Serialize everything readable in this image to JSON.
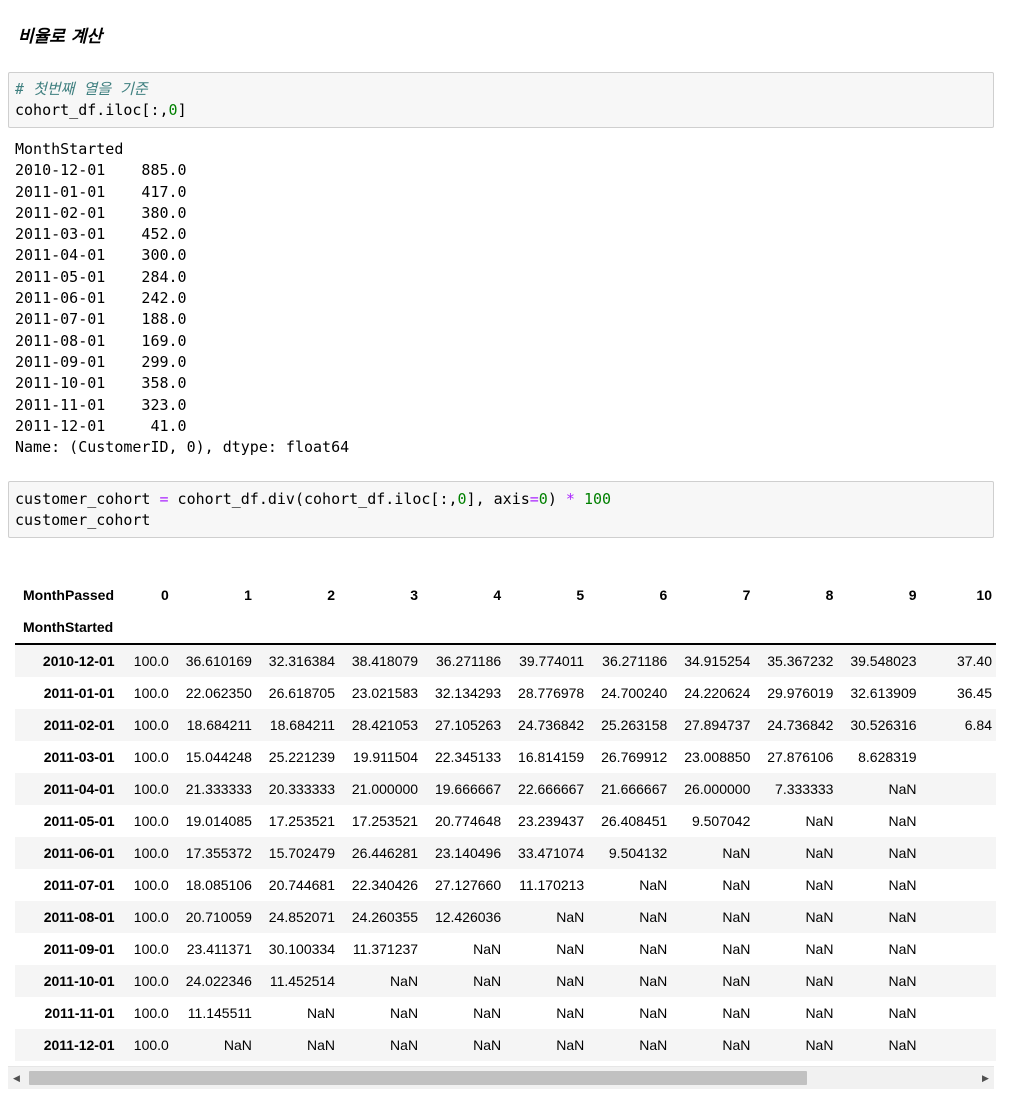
{
  "heading": "비율로 계산",
  "cell1": {
    "comment": "# 첫번째 열을 기준",
    "code_a": "cohort_df.iloc[:,",
    "code_num": "0",
    "code_b": "]"
  },
  "series_output": {
    "header": "MonthStarted",
    "rows": [
      "2010-12-01    885.0",
      "2011-01-01    417.0",
      "2011-02-01    380.0",
      "2011-03-01    452.0",
      "2011-04-01    300.0",
      "2011-05-01    284.0",
      "2011-06-01    242.0",
      "2011-07-01    188.0",
      "2011-08-01    169.0",
      "2011-09-01    299.0",
      "2011-10-01    358.0",
      "2011-11-01    323.0",
      "2011-12-01     41.0"
    ],
    "footer": "Name: (CustomerID, 0), dtype: float64"
  },
  "cell2": {
    "p1": "customer_cohort ",
    "eq": "=",
    "p2": " cohort_df.div(cohort_df.iloc[:,",
    "n0": "0",
    "p3": "], axis",
    "eq2": "=",
    "n1": "0",
    "p4": ") ",
    "star": "*",
    "sp": " ",
    "n100": "100",
    "line2": "customer_cohort"
  },
  "dataframe": {
    "columns_name": "MonthPassed",
    "index_name": "MonthStarted",
    "columns": [
      "0",
      "1",
      "2",
      "3",
      "4",
      "5",
      "6",
      "7",
      "8",
      "9",
      "10"
    ],
    "rows": [
      {
        "index": "2010-12-01",
        "values": [
          "100.0",
          "36.610169",
          "32.316384",
          "38.418079",
          "36.271186",
          "39.774011",
          "36.271186",
          "34.915254",
          "35.367232",
          "39.548023",
          "37.40"
        ]
      },
      {
        "index": "2011-01-01",
        "values": [
          "100.0",
          "22.062350",
          "26.618705",
          "23.021583",
          "32.134293",
          "28.776978",
          "24.700240",
          "24.220624",
          "29.976019",
          "32.613909",
          "36.45"
        ]
      },
      {
        "index": "2011-02-01",
        "values": [
          "100.0",
          "18.684211",
          "18.684211",
          "28.421053",
          "27.105263",
          "24.736842",
          "25.263158",
          "27.894737",
          "24.736842",
          "30.526316",
          "6.84"
        ]
      },
      {
        "index": "2011-03-01",
        "values": [
          "100.0",
          "15.044248",
          "25.221239",
          "19.911504",
          "22.345133",
          "16.814159",
          "26.769912",
          "23.008850",
          "27.876106",
          "8.628319",
          ""
        ]
      },
      {
        "index": "2011-04-01",
        "values": [
          "100.0",
          "21.333333",
          "20.333333",
          "21.000000",
          "19.666667",
          "22.666667",
          "21.666667",
          "26.000000",
          "7.333333",
          "NaN",
          ""
        ]
      },
      {
        "index": "2011-05-01",
        "values": [
          "100.0",
          "19.014085",
          "17.253521",
          "17.253521",
          "20.774648",
          "23.239437",
          "26.408451",
          "9.507042",
          "NaN",
          "NaN",
          ""
        ]
      },
      {
        "index": "2011-06-01",
        "values": [
          "100.0",
          "17.355372",
          "15.702479",
          "26.446281",
          "23.140496",
          "33.471074",
          "9.504132",
          "NaN",
          "NaN",
          "NaN",
          ""
        ]
      },
      {
        "index": "2011-07-01",
        "values": [
          "100.0",
          "18.085106",
          "20.744681",
          "22.340426",
          "27.127660",
          "11.170213",
          "NaN",
          "NaN",
          "NaN",
          "NaN",
          ""
        ]
      },
      {
        "index": "2011-08-01",
        "values": [
          "100.0",
          "20.710059",
          "24.852071",
          "24.260355",
          "12.426036",
          "NaN",
          "NaN",
          "NaN",
          "NaN",
          "NaN",
          ""
        ]
      },
      {
        "index": "2011-09-01",
        "values": [
          "100.0",
          "23.411371",
          "30.100334",
          "11.371237",
          "NaN",
          "NaN",
          "NaN",
          "NaN",
          "NaN",
          "NaN",
          ""
        ]
      },
      {
        "index": "2011-10-01",
        "values": [
          "100.0",
          "24.022346",
          "11.452514",
          "NaN",
          "NaN",
          "NaN",
          "NaN",
          "NaN",
          "NaN",
          "NaN",
          ""
        ]
      },
      {
        "index": "2011-11-01",
        "values": [
          "100.0",
          "11.145511",
          "NaN",
          "NaN",
          "NaN",
          "NaN",
          "NaN",
          "NaN",
          "NaN",
          "NaN",
          ""
        ]
      },
      {
        "index": "2011-12-01",
        "values": [
          "100.0",
          "NaN",
          "NaN",
          "NaN",
          "NaN",
          "NaN",
          "NaN",
          "NaN",
          "NaN",
          "NaN",
          ""
        ]
      }
    ]
  },
  "scrollbar": {
    "left_icon": "arrow-left-icon",
    "right_icon": "arrow-right-icon"
  }
}
